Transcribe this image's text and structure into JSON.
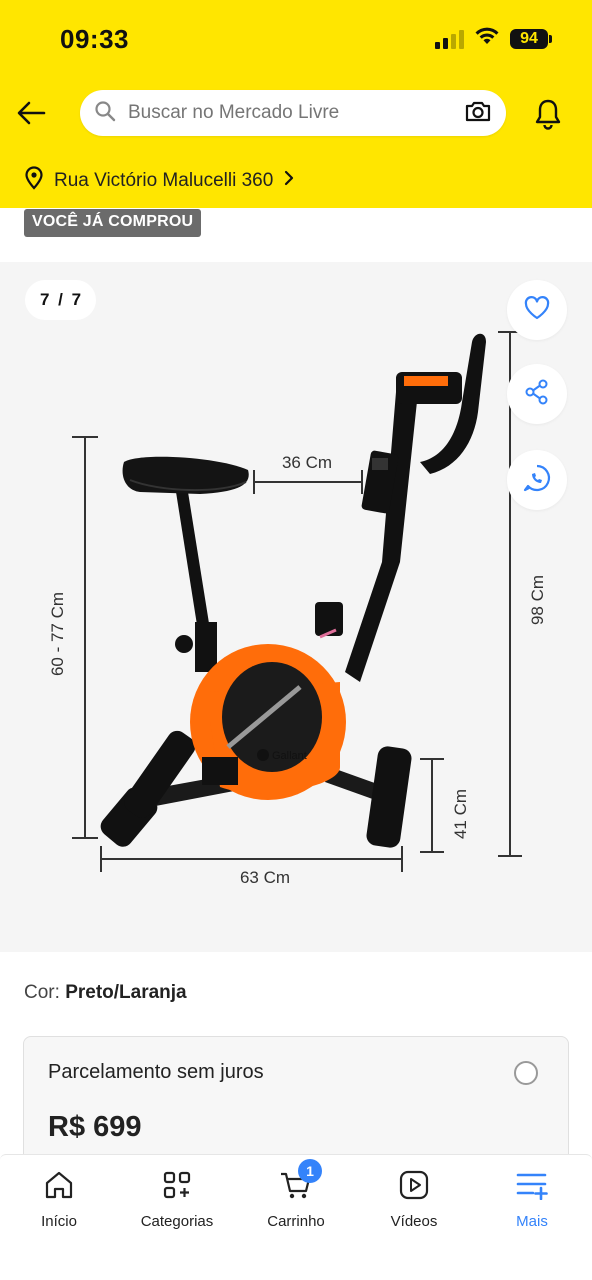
{
  "status_bar": {
    "time": "09:33",
    "battery": "94"
  },
  "header": {
    "search_placeholder": "Buscar no Mercado Livre",
    "address": "Rua Victório Malucelli 360"
  },
  "badge": "VOCÊ JÁ COMPROU",
  "gallery": {
    "counter": "7 / 7",
    "dimensions": {
      "seat_to_handle": "36 Cm",
      "seat_height": "60 - 77 Cm",
      "total_height": "98 Cm",
      "length": "63 Cm",
      "foot_width": "41 Cm"
    },
    "brand": "Gallant"
  },
  "product": {
    "color_label": "Cor:",
    "color_value": "Preto/Laranja"
  },
  "payment_card": {
    "title": "Parcelamento sem juros",
    "price": "R$ 699"
  },
  "bottom_nav": {
    "items": [
      {
        "label": "Início",
        "icon": "home-icon"
      },
      {
        "label": "Categorias",
        "icon": "categories-icon"
      },
      {
        "label": "Carrinho",
        "icon": "cart-icon",
        "badge": "1"
      },
      {
        "label": "Vídeos",
        "icon": "video-icon"
      },
      {
        "label": "Mais",
        "icon": "more-icon",
        "active": true
      }
    ]
  },
  "colors": {
    "header_bg": "#ffe600",
    "accent_blue": "#3483fa",
    "bike_orange": "#ff6d0a"
  }
}
